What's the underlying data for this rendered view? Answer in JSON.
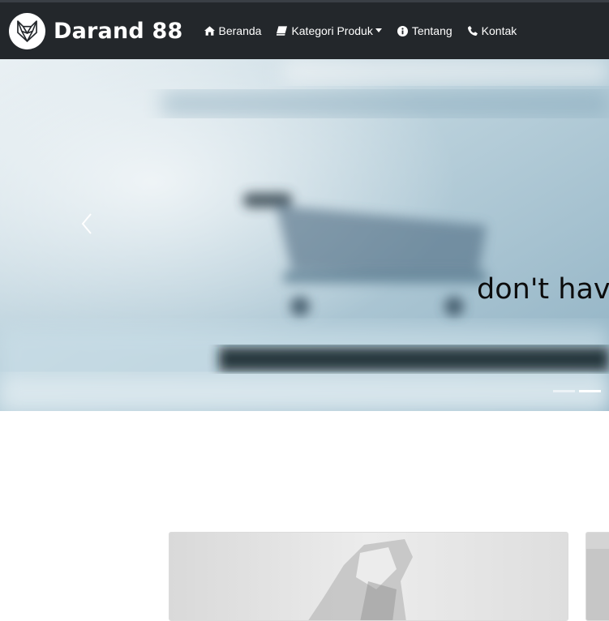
{
  "brand": {
    "name": "Darand 88",
    "logo_icon": "fox-logo-icon"
  },
  "nav": {
    "items": [
      {
        "label": "Beranda",
        "icon": "home-icon"
      },
      {
        "label": "Kategori Produk",
        "icon": "book-icon",
        "dropdown": true
      },
      {
        "label": "Tentang",
        "icon": "info-icon"
      },
      {
        "label": "Kontak",
        "icon": "phone-icon"
      }
    ]
  },
  "carousel": {
    "caption": "don't have",
    "slide_count": 2,
    "active_index": 1
  },
  "colors": {
    "navbar_bg": "#23272b",
    "hero_tint": "#bcd3dd",
    "caption_text": "#0c0c0c"
  }
}
